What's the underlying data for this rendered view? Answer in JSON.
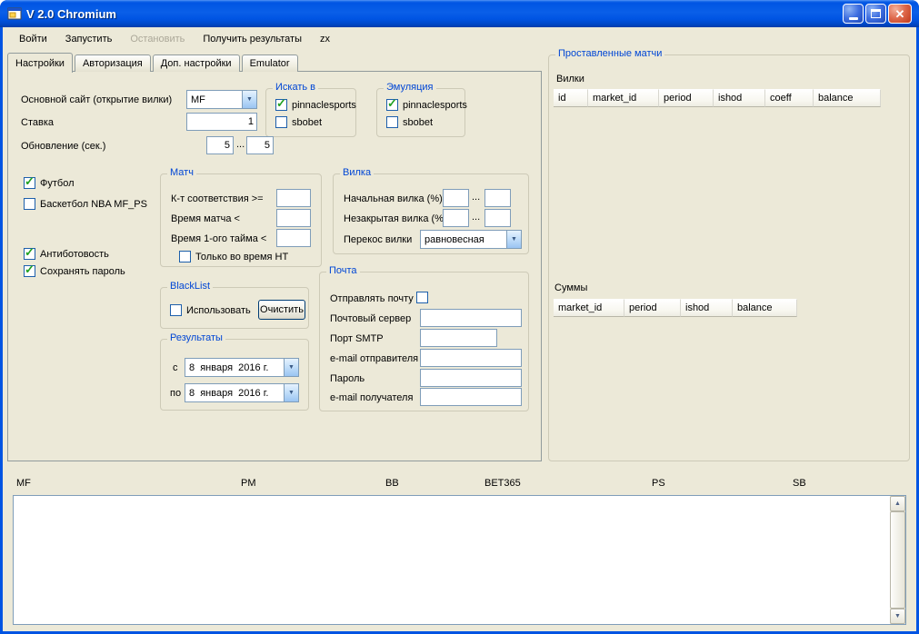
{
  "theme": {
    "titlebar_blue": "#0054E3",
    "window_face": "#ECE9D8",
    "group_caption_color": "#0046D5",
    "disabled_menu_color": "#ACA899",
    "close_button_red": "#DD6547",
    "input_border": "#7F9DB9",
    "check_green": "#21A121"
  },
  "icons": {
    "dropdown": "▼",
    "check": "✓",
    "close": "✕",
    "scroll_up": "▲",
    "scroll_down": "▼"
  },
  "window": {
    "title": "V 2.0 Chromium"
  },
  "menu": {
    "items": [
      {
        "label": "Войти",
        "enabled": true
      },
      {
        "label": "Запустить",
        "enabled": true
      },
      {
        "label": "Остановить",
        "enabled": false
      },
      {
        "label": "Получить результаты",
        "enabled": true
      },
      {
        "label": "zx",
        "enabled": true
      }
    ]
  },
  "tabs": {
    "items": [
      {
        "label": "Настройки",
        "active": true
      },
      {
        "label": "Авторизация",
        "active": false
      },
      {
        "label": "Доп. настройки",
        "active": false
      },
      {
        "label": "Emulator",
        "active": false
      }
    ]
  },
  "settings": {
    "main_site_label": "Основной сайт (открытие вилки)",
    "main_site_value": "MF",
    "stake_label": "Ставка",
    "stake_value": "1",
    "refresh_label": "Обновление (сек.)",
    "refresh_from": "5",
    "refresh_to": "5",
    "range_dots": "...",
    "football": {
      "label": "Футбол",
      "checked": true
    },
    "basketball": {
      "label": "Баскетбол NBA MF_PS",
      "checked": false
    },
    "antibot": {
      "label": "Антиботовость",
      "checked": true
    },
    "save_password": {
      "label": "Сохранять пароль",
      "checked": true
    },
    "search_in": {
      "title": "Искать в",
      "pinnaclesports": {
        "label": "pinnaclesports",
        "checked": true
      },
      "sbobet": {
        "label": "sbobet",
        "checked": false
      }
    },
    "emulation": {
      "title": "Эмуляция",
      "pinnaclesports": {
        "label": "pinnaclesports",
        "checked": true
      },
      "sbobet": {
        "label": "sbobet",
        "checked": false
      }
    },
    "match": {
      "title": "Матч",
      "coef_label": "К-т соответствия >=",
      "coef_value": "",
      "time_label": "Время матча <",
      "time_value": "",
      "half_label": "Время 1-ого тайма <",
      "half_value": "",
      "ht_only": {
        "label": "Только во время HT",
        "checked": false
      }
    },
    "fork": {
      "title": "Вилка",
      "initial_label": "Начальная вилка (%)",
      "unclosed_label": "Незакрытая вилка (%)",
      "skew_label": "Перекос вилки",
      "skew_value": "равновесная"
    },
    "blacklist": {
      "title": "BlackList",
      "use": {
        "label": "Использовать",
        "checked": false
      },
      "clear_button": "Очистить"
    },
    "results": {
      "title": "Результаты",
      "from_label": "с",
      "from_value": "8  января  2016 г.",
      "to_label": "по",
      "to_value": "8  января  2016 г."
    },
    "mail": {
      "title": "Почта",
      "send_label": "Отправлять почту",
      "send_checked": false,
      "server_label": "Почтовый сервер",
      "smtp_label": "Порт SMTP",
      "sender_label": "e-mail отправителя",
      "password_label": "Пароль",
      "recipient_label": "e-mail получателя"
    }
  },
  "placed": {
    "title": "Проставленные матчи",
    "forks_label": "Вилки",
    "forks_columns": [
      "id",
      "market_id",
      "period",
      "ishod",
      "coeff",
      "balance"
    ],
    "sums_label": "Суммы",
    "sums_columns": [
      "market_id",
      "period",
      "ishod",
      "balance"
    ]
  },
  "bottom": {
    "labels": [
      "MF",
      "PM",
      "BB",
      "BET365",
      "PS",
      "SB"
    ]
  }
}
